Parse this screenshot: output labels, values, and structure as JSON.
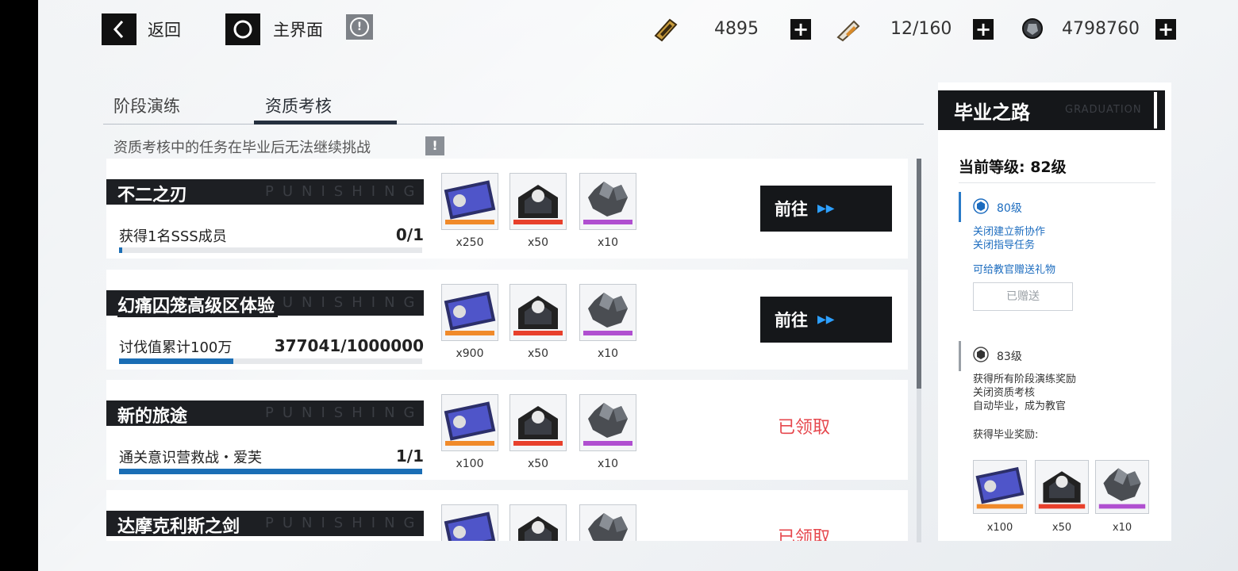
{
  "topbar": {
    "back_label": "返回",
    "home_label": "主界面",
    "resources": [
      {
        "icon": "cash-ticket-icon",
        "value": "4895"
      },
      {
        "icon": "stamina-tube-icon",
        "value": "12/160"
      },
      {
        "icon": "black-card-icon",
        "value": "4798760"
      }
    ]
  },
  "tabs": [
    {
      "label": "阶段演练",
      "active": false
    },
    {
      "label": "资质考核",
      "active": true
    }
  ],
  "notice": "资质考核中的任务在毕业后无法继续挑战",
  "watermark": "PUNISHING",
  "tasks": [
    {
      "title": "不二之刃",
      "desc": "获得1名SSS成员",
      "progress_text": "0/1",
      "progress": 0.01,
      "rewards": [
        "x250",
        "x50",
        "x10"
      ],
      "action": "前往",
      "claimed": false
    },
    {
      "title": "幻痛囚笼高级区体验",
      "desc": "讨伐值累计100万",
      "progress_text": "377041/1000000",
      "progress": 0.377,
      "rewards": [
        "x900",
        "x50",
        "x10"
      ],
      "action": "前往",
      "claimed": false
    },
    {
      "title": "新的旅途",
      "desc": "通关意识营救战・爱芙",
      "progress_text": "1/1",
      "progress": 1.0,
      "rewards": [
        "x100",
        "x50",
        "x10"
      ],
      "action": "已领取",
      "claimed": true
    },
    {
      "title": "达摩克利斯之剑",
      "desc": "",
      "progress_text": "",
      "progress": 0,
      "rewards": [
        "",
        "",
        ""
      ],
      "action": "已领取",
      "claimed": true
    }
  ],
  "reward_icons": [
    "exp-card-icon",
    "supply-box-icon",
    "ore-cluster-icon"
  ],
  "panel": {
    "title": "毕业之路",
    "title_watermark": "GRADUATION",
    "current_level": "当前等级: 82级",
    "milestone1": {
      "level": "80级",
      "lines": [
        "关闭建立新协作",
        "关闭指导任务"
      ],
      "gift_text": "可给教官赠送礼物",
      "gift_button": "已赠送"
    },
    "milestone2": {
      "level": "83级",
      "lines": [
        "获得所有阶段演练奖励",
        "关闭资质考核",
        "自动毕业，成为教官"
      ],
      "reward_title": "获得毕业奖励:",
      "rewards": [
        "x100",
        "x50",
        "x10"
      ]
    }
  },
  "colors": {
    "accent_blue": "#1b6eb5",
    "claimed_red": "#e6474d",
    "dark_bar": "#1d1f23"
  }
}
